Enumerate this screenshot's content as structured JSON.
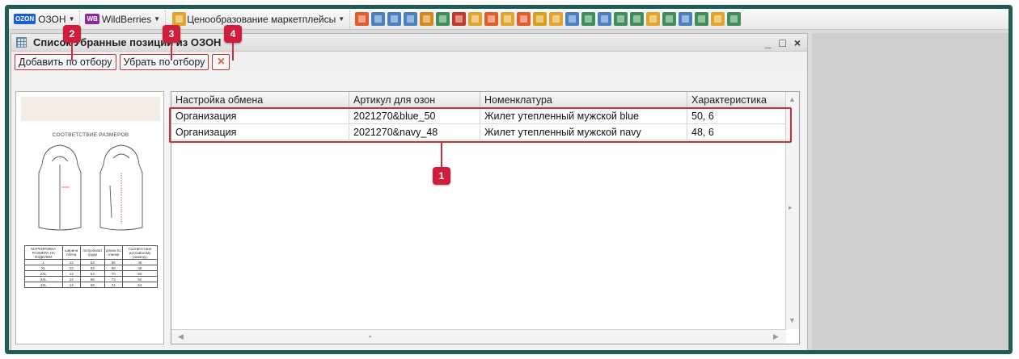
{
  "toolbar": {
    "ozon_badge": "OZON",
    "ozon_label": "ОЗОН",
    "wb_badge": "WB",
    "wb_label": "WildBerries",
    "pricing_label": "Ценообразование маркетплейсы",
    "icon_colors": [
      "#e25c2a",
      "#4a7fc1",
      "#4a7fc1",
      "#4a7fc1",
      "#d68a1c",
      "#3f8f5a",
      "#c0392b",
      "#e2a42a",
      "#e25c2a",
      "#e2a42a",
      "#e25c2a",
      "#d6a21c",
      "#e2a42a",
      "#4a7fc1",
      "#3f8f5a",
      "#4a7fc1",
      "#3f8f5a",
      "#3f8f5a",
      "#e2a42a",
      "#3f8f5a",
      "#4a7fc1",
      "#3f8f5a",
      "#e2a42a",
      "#3f8f5a"
    ]
  },
  "window": {
    "title": "Список Убранные позиции из ОЗОН",
    "controls": {
      "minimize": "_",
      "maximize": "□",
      "close": "×"
    },
    "commands": {
      "add_by_filter": "Добавить по отбору",
      "remove_by_filter": "Убрать по отбору",
      "delete": "×"
    }
  },
  "preview": {
    "title": "СООТВЕТСТВИЕ РАЗМЕРОВ",
    "table": {
      "headers": [
        "МАРКИРОВКА РАЗМЕРА НА ИЗДЕЛИИ",
        "ширина плеча",
        "полуобхват груди",
        "длина по спинке",
        "Соответствие российскому размеру"
      ],
      "rows": [
        [
          "L",
          "12",
          "52",
          "66",
          "46"
        ],
        [
          "XL",
          "12",
          "53",
          "68",
          "48"
        ],
        [
          "2XL",
          "13",
          "54",
          "70",
          "50"
        ],
        [
          "3XL",
          "14",
          "56",
          "72",
          "52"
        ],
        [
          "4XL",
          "14",
          "58",
          "74",
          "54"
        ]
      ]
    }
  },
  "grid": {
    "columns": [
      "Настройка обмена",
      "Артикул для озон",
      "Номенклатура",
      "Характеристика"
    ],
    "rows": [
      {
        "exchange": "Организация",
        "article": "2021270&blue_50",
        "nomenclature": "Жилет утепленный мужской blue",
        "characteristic": "50, 6"
      },
      {
        "exchange": "Организация",
        "article": "2021270&navy_48",
        "nomenclature": "Жилет утепленный мужской navy",
        "characteristic": "48, 6"
      }
    ]
  },
  "callouts": [
    "1",
    "2",
    "3",
    "4"
  ],
  "colors": {
    "frame": "#1f5c55",
    "highlight": "#c8303a",
    "callout": "#d01d3c"
  }
}
